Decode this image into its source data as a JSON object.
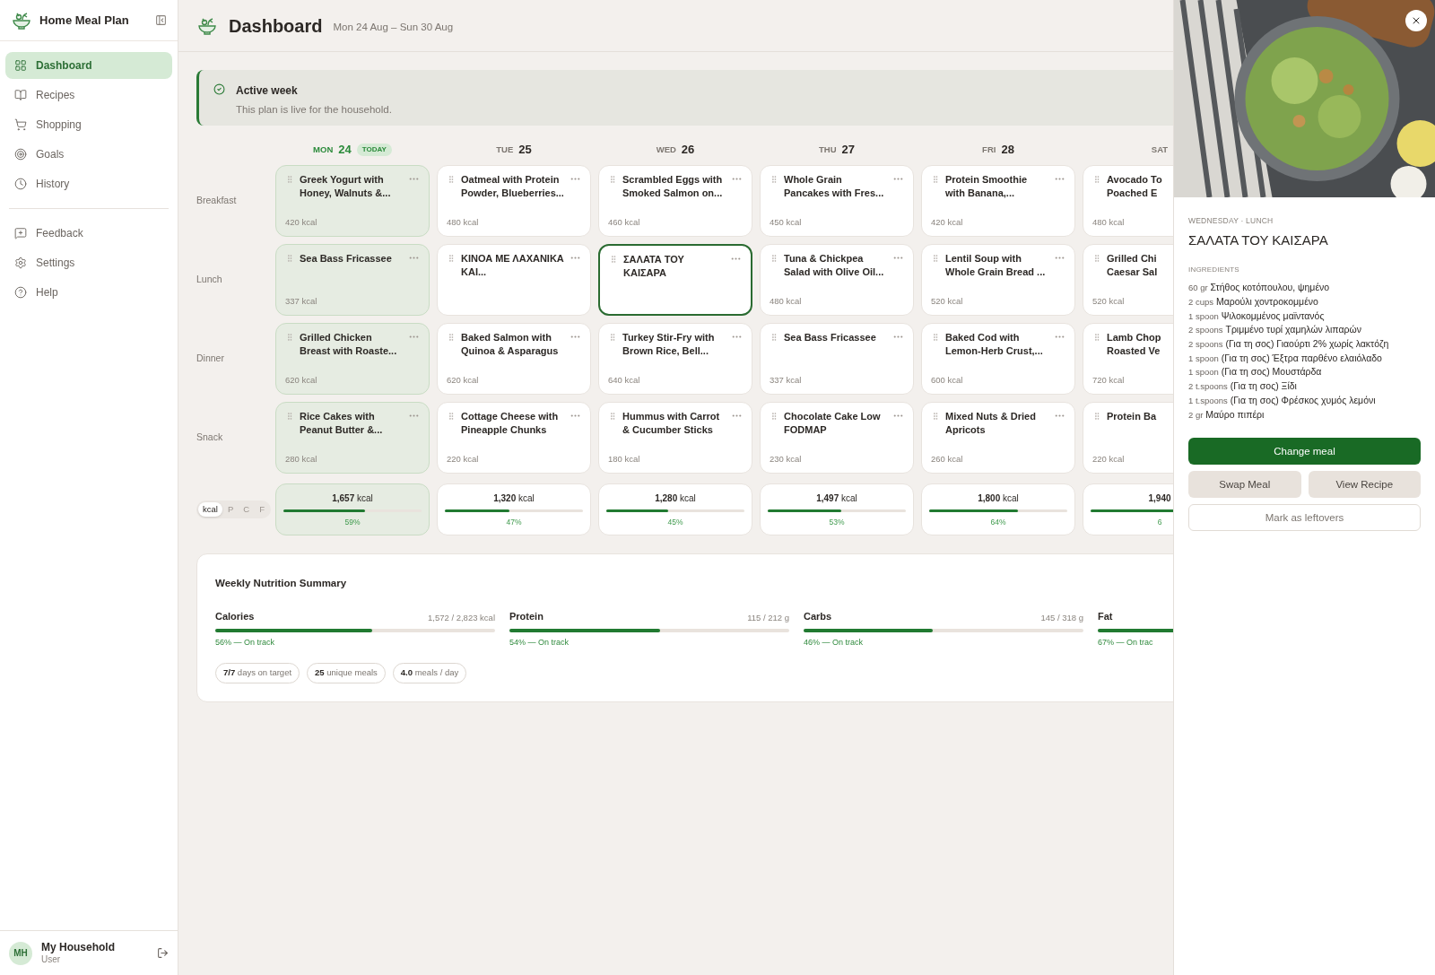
{
  "app": {
    "name": "Home Meal Plan"
  },
  "nav_main": [
    {
      "label": "Dashboard",
      "selected": true
    },
    {
      "label": "Recipes",
      "selected": false
    },
    {
      "label": "Shopping",
      "selected": false
    },
    {
      "label": "Goals",
      "selected": false
    },
    {
      "label": "History",
      "selected": false
    }
  ],
  "nav_secondary": [
    {
      "label": "Feedback",
      "selected": false
    },
    {
      "label": "Settings",
      "selected": false
    },
    {
      "label": "Help",
      "selected": false
    }
  ],
  "user": {
    "initials": "MH",
    "name": "My Household",
    "role": "User"
  },
  "header": {
    "title": "Dashboard",
    "range": "Mon 24 Aug – Sun 30 Aug"
  },
  "banner": {
    "title": "Active week",
    "text": "This plan is live for the household."
  },
  "meal_types": [
    "Breakfast",
    "Lunch",
    "Dinner",
    "Snack"
  ],
  "metric_toggle": [
    {
      "label": "kcal",
      "selected": true
    },
    {
      "label": "P",
      "selected": false
    },
    {
      "label": "C",
      "selected": false
    },
    {
      "label": "F",
      "selected": false
    }
  ],
  "days": [
    {
      "weekday": "MON",
      "date": "24",
      "today": true,
      "badge": "TODAY",
      "meals": [
        {
          "title": "Greek Yogurt with Honey, Walnuts &...",
          "kcal": "420 kcal",
          "selected": false
        },
        {
          "title": "Sea Bass Fricassee",
          "kcal": "337 kcal",
          "selected": false
        },
        {
          "title": "Grilled Chicken Breast with Roaste...",
          "kcal": "620 kcal",
          "selected": false
        },
        {
          "title": "Rice Cakes with Peanut Butter &...",
          "kcal": "280 kcal",
          "selected": false
        }
      ],
      "total": {
        "value": "1,657",
        "unit": "kcal",
        "level": 0.59,
        "percent": "59%"
      }
    },
    {
      "weekday": "TUE",
      "date": "25",
      "today": false,
      "meals": [
        {
          "title": "Oatmeal with Protein Powder, Blueberries...",
          "kcal": "480 kcal",
          "selected": false
        },
        {
          "title": "ΚΙΝΟΑ ΜΕ ΛΑΧΑΝΙΚΑ ΚΑΙ...",
          "selected": false
        },
        {
          "title": "Baked Salmon with Quinoa & Asparagus",
          "kcal": "620 kcal",
          "selected": false
        },
        {
          "title": "Cottage Cheese with Pineapple Chunks",
          "kcal": "220 kcal",
          "selected": false
        }
      ],
      "total": {
        "value": "1,320",
        "unit": "kcal",
        "level": 0.47,
        "percent": "47%"
      }
    },
    {
      "weekday": "WED",
      "date": "26",
      "today": false,
      "meals": [
        {
          "title": "Scrambled Eggs with Smoked Salmon on...",
          "kcal": "460 kcal",
          "selected": false
        },
        {
          "title": "ΣΑΛΑΤΑ ΤΟΥ ΚΑΙΣΑΡΑ",
          "selected": true
        },
        {
          "title": "Turkey Stir-Fry with Brown Rice, Bell...",
          "kcal": "640 kcal",
          "selected": false
        },
        {
          "title": "Hummus with Carrot & Cucumber Sticks",
          "kcal": "180 kcal",
          "selected": false
        }
      ],
      "total": {
        "value": "1,280",
        "unit": "kcal",
        "level": 0.45,
        "percent": "45%"
      }
    },
    {
      "weekday": "THU",
      "date": "27",
      "today": false,
      "meals": [
        {
          "title": "Whole Grain Pancakes with Fres...",
          "kcal": "450 kcal",
          "selected": false
        },
        {
          "title": "Tuna & Chickpea Salad with Olive Oil...",
          "kcal": "480 kcal",
          "selected": false
        },
        {
          "title": "Sea Bass Fricassee",
          "kcal": "337 kcal",
          "selected": false
        },
        {
          "title": "Chocolate Cake Low FODMAP",
          "kcal": "230 kcal",
          "selected": false
        }
      ],
      "total": {
        "value": "1,497",
        "unit": "kcal",
        "level": 0.53,
        "percent": "53%"
      }
    },
    {
      "weekday": "FRI",
      "date": "28",
      "today": false,
      "meals": [
        {
          "title": "Protein Smoothie with Banana,...",
          "kcal": "420 kcal",
          "selected": false
        },
        {
          "title": "Lentil Soup with Whole Grain Bread ...",
          "kcal": "520 kcal",
          "selected": false
        },
        {
          "title": "Baked Cod with Lemon-Herb Crust,...",
          "kcal": "600 kcal",
          "selected": false
        },
        {
          "title": "Mixed Nuts & Dried Apricots",
          "kcal": "260 kcal",
          "selected": false
        }
      ],
      "total": {
        "value": "1,800",
        "unit": "kcal",
        "level": 0.64,
        "percent": "64%"
      }
    },
    {
      "weekday": "SAT",
      "today": false,
      "meals": [
        {
          "title": "Avocado To\nPoached E",
          "kcal": "480 kcal",
          "selected": false
        },
        {
          "title": "Grilled Chi\nCaesar Sal",
          "kcal": "520 kcal",
          "selected": false
        },
        {
          "title": "Lamb Chop\nRoasted Ve",
          "kcal": "720 kcal",
          "selected": false
        },
        {
          "title": "Protein Ba",
          "kcal": "220 kcal",
          "selected": false
        }
      ],
      "total": {
        "value": "1,940",
        "level": 0.69,
        "percent": "6"
      }
    }
  ],
  "summary": {
    "title": "Weekly Nutrition Summary",
    "nutrients": [
      {
        "name": "Calories",
        "amount": "1,572 / 2,823 kcal",
        "level": 0.56,
        "status": "56% — On track"
      },
      {
        "name": "Protein",
        "amount": "115 / 212 g",
        "level": 0.54,
        "status": "54% — On track"
      },
      {
        "name": "Carbs",
        "amount": "145 / 318 g",
        "level": 0.46,
        "status": "46% — On track"
      },
      {
        "name": "Fat",
        "level": 0.67,
        "status": "67% — On trac"
      }
    ],
    "stats": [
      {
        "value": "7/7",
        "label": "days on target"
      },
      {
        "value": "25",
        "label": "unique meals"
      },
      {
        "value": "4.0",
        "label": "meals / day"
      }
    ]
  },
  "detail": {
    "eyebrow": "WEDNESDAY · LUNCH",
    "title": "ΣΑΛΑΤΑ ΤΟΥ ΚΑΙΣΑΡΑ",
    "section": "INGREDIENTS",
    "ingredients": [
      {
        "amount": "60 gr",
        "name": "Στήθος κοτόπουλου, ψημένο"
      },
      {
        "amount": "2 cups",
        "name": "Μαρούλι χοντροκομμένο"
      },
      {
        "amount": "1 spoon",
        "name": "Ψιλοκομμένος μαϊντανός"
      },
      {
        "amount": "2 spoons",
        "name": "Τριμμένο τυρί χαμηλών λιπαρών"
      },
      {
        "amount": "2 spoons",
        "name": "(Για τη σος) Γιαούρτι 2% χωρίς λακτόζη"
      },
      {
        "amount": "1 spoon",
        "name": "(Για τη σος) Έξτρα παρθένο ελαιόλαδο"
      },
      {
        "amount": "1 spoon",
        "name": "(Για τη σος) Μουστάρδα"
      },
      {
        "amount": "2 t.spoons",
        "name": "(Για τη σος) Ξίδι"
      },
      {
        "amount": "1 t.spoons",
        "name": "(Για τη σος) Φρέσκος χυμός λεμόνι"
      },
      {
        "amount": "2 gr",
        "name": "Μαύρο πιπέρι"
      }
    ],
    "primary_button": "Change meal",
    "secondary_buttons": [
      "Swap Meal",
      "View Recipe"
    ],
    "tertiary_button": "Mark as leftovers"
  }
}
